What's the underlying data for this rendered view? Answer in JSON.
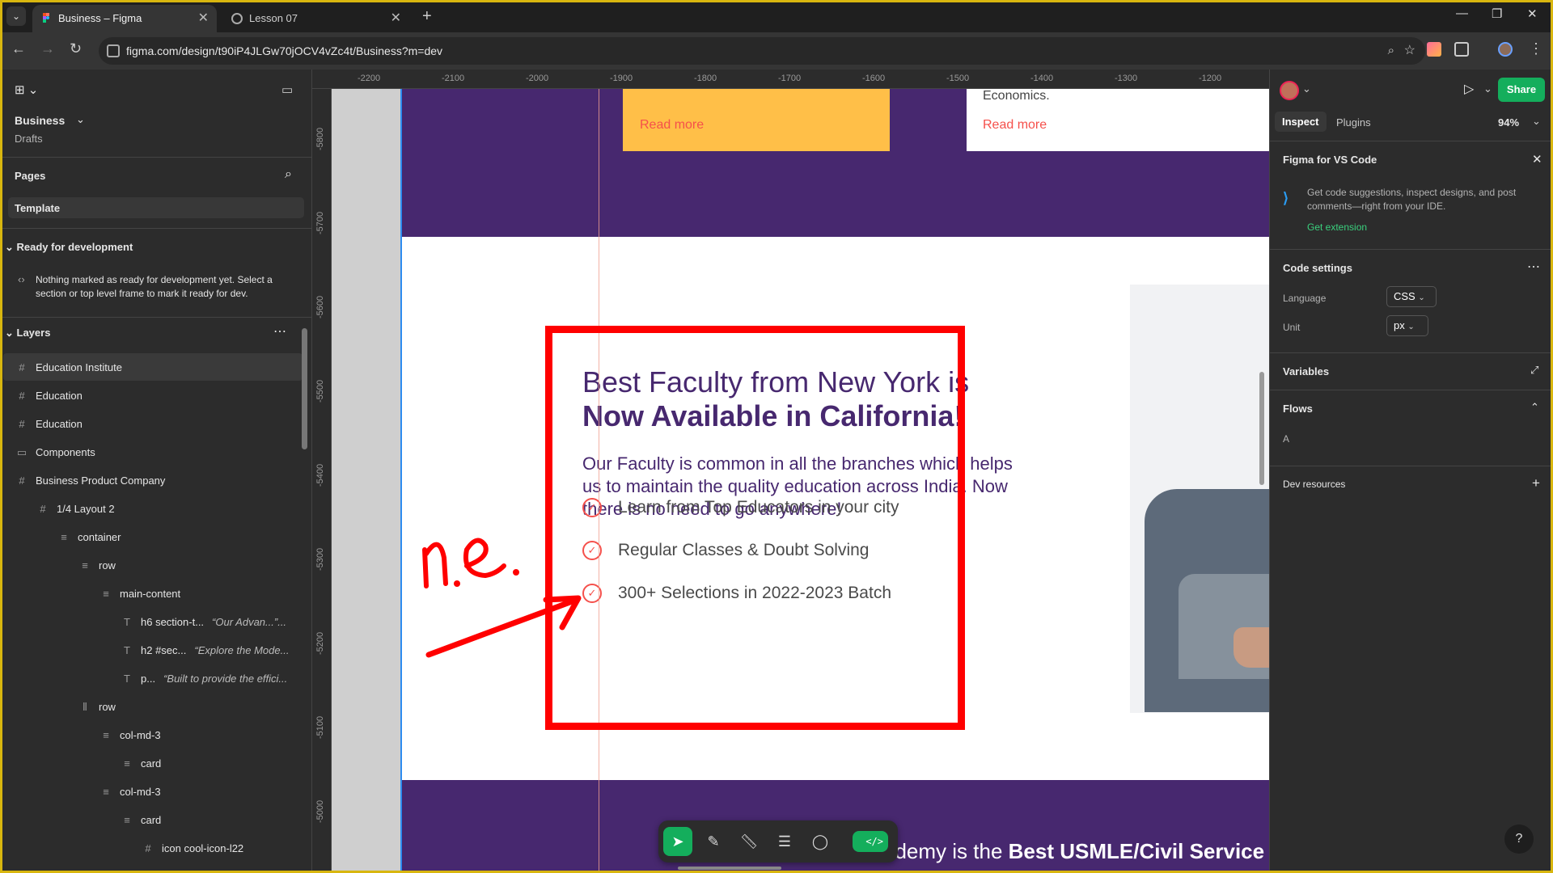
{
  "browser": {
    "tabs": [
      {
        "title": "Business – Figma",
        "active": true
      },
      {
        "title": "Lesson 07",
        "active": false
      }
    ],
    "url": "figma.com/design/t90iP4JLGw70jOCV4vZc4t/Business?m=dev"
  },
  "left_panel": {
    "file_name": "Business",
    "location": "Drafts",
    "pages_title": "Pages",
    "current_page": "Template",
    "ready_title": "Ready for development",
    "ready_message": "Nothing marked as ready for development yet. Select a section or top level frame to mark it ready for dev.",
    "layers_title": "Layers",
    "layers": [
      {
        "label": "Education Institute",
        "indent": 0,
        "icon": "frame-icon",
        "selected": true
      },
      {
        "label": "Education",
        "indent": 0,
        "icon": "frame-icon"
      },
      {
        "label": "Education",
        "indent": 0,
        "icon": "frame-icon"
      },
      {
        "label": "Components",
        "indent": 0,
        "icon": "section-icon"
      },
      {
        "label": "Business Product Company",
        "indent": 0,
        "icon": "frame-icon"
      },
      {
        "label": "1/4 Layout 2",
        "indent": 1,
        "icon": "frame-icon"
      },
      {
        "label": "container",
        "indent": 2,
        "icon": "autolayout-icon"
      },
      {
        "label": "row",
        "indent": 3,
        "icon": "autolayout-icon"
      },
      {
        "label": "main-content",
        "indent": 4,
        "icon": "autolayout-icon"
      },
      {
        "label": "h6 section-t...",
        "sub": "“Our Advan...”...",
        "indent": 5,
        "icon": "text-icon"
      },
      {
        "label": "h2 #sec...",
        "sub": "“Explore the Mode...",
        "indent": 5,
        "icon": "text-icon"
      },
      {
        "label": "p...",
        "sub": "“Built to provide the effici...",
        "indent": 5,
        "icon": "text-icon"
      },
      {
        "label": "row",
        "indent": 3,
        "icon": "columns-icon"
      },
      {
        "label": "col-md-3",
        "indent": 4,
        "icon": "autolayout-icon"
      },
      {
        "label": "card",
        "indent": 5,
        "icon": "autolayout-icon"
      },
      {
        "label": "col-md-3",
        "indent": 4,
        "icon": "autolayout-icon"
      },
      {
        "label": "card",
        "indent": 5,
        "icon": "autolayout-icon"
      },
      {
        "label": "icon cool-icon-l22",
        "indent": 6,
        "icon": "frame-icon"
      }
    ]
  },
  "rulers": {
    "top": [
      "-2200",
      "-2100",
      "-2000",
      "-1900",
      "-1800",
      "-1700",
      "-1600",
      "-1500",
      "-1400",
      "-1300",
      "-1200"
    ],
    "left": [
      "-5800",
      "-5700",
      "-5600",
      "-5500",
      "-5400",
      "-5300",
      "-5200",
      "-5100",
      "-5000"
    ]
  },
  "canvas": {
    "card_yellow_link": "Read more",
    "card_white_text": "Economics.",
    "card_white_link": "Read more",
    "heading_line1": "Best Faculty from New York is",
    "heading_line2": "Now Available in California!",
    "paragraph": "Our Faculty is common in all the branches which helps us to maintain the quality education across India. Now there is no need to go anywhere!",
    "features": [
      "Learn from Top Educators in your city",
      "Regular Classes & Doubt Solving",
      "300+ Selections in 2022-2023 Batch"
    ],
    "bottom_text_normal": "ademy is the ",
    "bottom_text_bold": "Best USMLE/Civil Service",
    "annotation_text": "n.e.",
    "colors": {
      "purple": "#47286f",
      "yellow": "#ffbf48",
      "accent_red": "#f5504b",
      "annotation_red": "#ff0000"
    }
  },
  "right_panel": {
    "share_label": "Share",
    "tab_inspect": "Inspect",
    "tab_plugins": "Plugins",
    "zoom": "94%",
    "vscode_title": "Figma for VS Code",
    "vscode_desc": "Get code suggestions, inspect designs, and post comments—right from your IDE.",
    "vscode_link": "Get extension",
    "code_settings_title": "Code settings",
    "language_label": "Language",
    "language_value": "CSS",
    "unit_label": "Unit",
    "unit_value": "px",
    "variables_title": "Variables",
    "flows_title": "Flows",
    "flow_item": "A",
    "dev_resources_title": "Dev resources"
  }
}
